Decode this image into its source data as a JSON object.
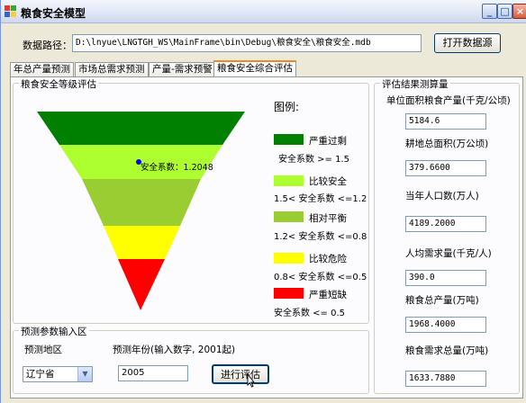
{
  "window": {
    "title": "粮食安全模型",
    "controls": [
      "minimize",
      "maximize",
      "close"
    ]
  },
  "path": {
    "label": "数据路径：",
    "value": "D:\\lnyue\\LNGTGH_WS\\MainFrame\\bin\\Debug\\粮食安全\\粮食安全.mdb",
    "open_button": "打开数据源"
  },
  "tabs": [
    {
      "label": "年总产量预测",
      "active": false
    },
    {
      "label": "市场总需求预测",
      "active": false
    },
    {
      "label": "产量-需求预警",
      "active": false
    },
    {
      "label": "粮食安全综合评估",
      "active": true
    }
  ],
  "grade_group": {
    "title": "粮食安全等级评估",
    "marker_label": "安全系数：1.2048",
    "marker_value": 1.2048,
    "legend_title": "图例:",
    "levels": [
      {
        "name": "严重过剩",
        "range": "安全系数 >= 1.5",
        "color": "#008000"
      },
      {
        "name": "比较安全",
        "range": "1.5< 安全系数 <=1.2",
        "color": "#adff2f"
      },
      {
        "name": "相对平衡",
        "range": "1.2< 安全系数 <=0.8",
        "color": "#9acd32"
      },
      {
        "name": "比较危险",
        "range": "0.8< 安全系数 <=0.5",
        "color": "#ffff00"
      },
      {
        "name": "严重短缺",
        "range": "安全系数 <= 0.5",
        "color": "#ff0000"
      }
    ]
  },
  "results_group": {
    "title": "评估结果测算量",
    "fields": [
      {
        "label": "单位面积粮食产量(千克/公顷)",
        "value": "5184.6"
      },
      {
        "label": "耕地总面积(万公顷)",
        "value": "379.6600"
      },
      {
        "label": "当年人口数(万人)",
        "value": "4189.2000"
      },
      {
        "label": "人均需求量(千克/人)",
        "value": "390.0"
      },
      {
        "label": "粮食总产量(万吨)",
        "value": "1968.4000"
      },
      {
        "label": "粮食需求总量(万吨)",
        "value": "1633.7880"
      }
    ]
  },
  "input_group": {
    "title": "预测参数输入区",
    "region_label": "预测地区",
    "region_value": "辽宁省",
    "year_label": "预测年份(输入数字, 2001起)",
    "year_value": "2005",
    "evaluate_button": "进行评估"
  }
}
